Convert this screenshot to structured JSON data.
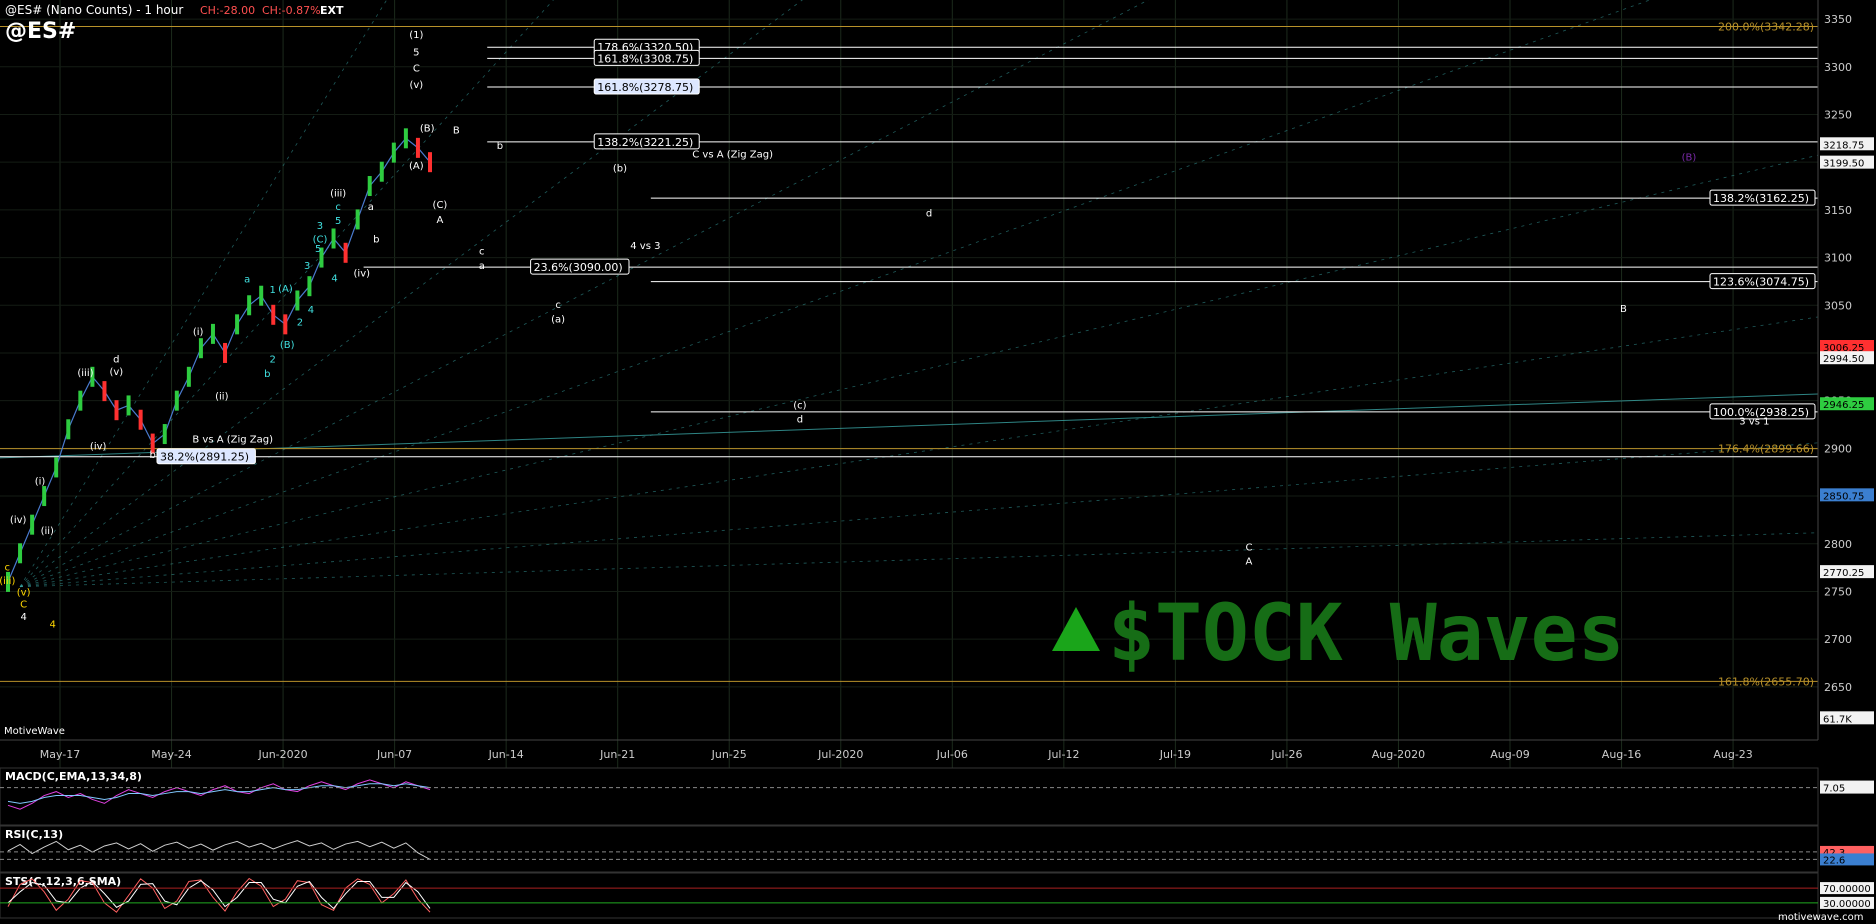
{
  "header": {
    "title": "@ES# (Nano Counts) - 1 hour",
    "change_abs": "CH:-28.00",
    "change_pct": "CH:-0.87%",
    "session": "EXT",
    "symbol": "@ES#"
  },
  "watermark": {
    "brand": "$TOCK Waves",
    "provider": "MotiveWave",
    "footer_url": "motivewave.com"
  },
  "colors": {
    "background": "#000000",
    "grid": "#1c2a1c",
    "fib_line": "#ffffff",
    "gold_line": "#b8912a",
    "fan_line": "#3aa6a6",
    "macd_main": "#e040e0",
    "macd_signal": "#80c8ff",
    "rsi": "#cfcfcf",
    "stoch_k": "#ff6060",
    "stoch_d": "#ffffff",
    "up_candle": "#2ecc40",
    "down_candle": "#ff3030",
    "brand_green": "#1aa51a",
    "brand_brown": "#6b4a1f"
  },
  "chart_data": [
    {
      "type": "line",
      "title": "@ES# (Nano Counts) - 1 hour",
      "ylim": [
        2610,
        3370
      ],
      "y_ticks": [
        2650,
        2700,
        2750,
        2800,
        2850,
        2900,
        2950,
        3000,
        3050,
        3100,
        3150,
        3200,
        3250,
        3300,
        3350
      ],
      "x_ticks": [
        "May-17",
        "May-24",
        "Jun-2020",
        "Jun-07",
        "Jun-14",
        "Jun-21",
        "Jun-25",
        "Jul-2020",
        "Jul-06",
        "Jul-12",
        "Jul-19",
        "Jul-26",
        "Aug-2020",
        "Aug-09",
        "Aug-16",
        "Aug-23"
      ],
      "price_series": {
        "name": "@ES#",
        "values": [
          2760,
          2790,
          2820,
          2850,
          2880,
          2920,
          2950,
          2975,
          2960,
          2940,
          2945,
          2930,
          2905,
          2915,
          2950,
          2975,
          3005,
          3020,
          3000,
          3030,
          3050,
          3060,
          3040,
          3030,
          3055,
          3070,
          3100,
          3120,
          3105,
          3140,
          3175,
          3190,
          3210,
          3225,
          3215,
          3200
        ]
      },
      "price_tags": [
        {
          "label": "3218.75",
          "value": 3218.75,
          "color": "#ffffff"
        },
        {
          "label": "3199.50",
          "value": 3199.5,
          "color": "#ffffff"
        },
        {
          "label": "3006.25",
          "value": 3006.25,
          "color": "#ff3030"
        },
        {
          "label": "2994.50",
          "value": 2994.5,
          "color": "#ffffff"
        },
        {
          "label": "2946.25",
          "value": 2946.25,
          "color": "#2ecc40"
        },
        {
          "label": "2850.75",
          "value": 2850.75,
          "color": "#3b7fd0"
        },
        {
          "label": "2770.25",
          "value": 2770.25,
          "color": "#ffffff"
        },
        {
          "label": "61.7K",
          "value": 2617,
          "color": "#ffffff"
        }
      ],
      "fib_levels": [
        {
          "label": "200.0%(3342.28)",
          "value": 3342.28,
          "color": "#b8912a",
          "start": 0.0,
          "boxed": false
        },
        {
          "label": "178.6%(3320.50)",
          "value": 3320.5,
          "color": "#ffffff",
          "start": 0.268,
          "boxed": true
        },
        {
          "label": "161.8%(3308.75)",
          "value": 3308.75,
          "color": "#ffffff",
          "start": 0.268,
          "boxed": true
        },
        {
          "label": "161.8%(3278.75)",
          "value": 3278.75,
          "color": "#ffffff",
          "start": 0.268,
          "boxed": true
        },
        {
          "label": "138.2%(3221.25)",
          "value": 3221.25,
          "color": "#ffffff",
          "start": 0.268,
          "boxed": true
        },
        {
          "label": "138.2%(3162.25)",
          "value": 3162.25,
          "color": "#ffffff",
          "start": 0.358,
          "boxed": true
        },
        {
          "label": "23.6%(3090.00)",
          "value": 3090.0,
          "color": "#ffffff",
          "start": 0.2,
          "boxed": true
        },
        {
          "label": "123.6%(3074.75)",
          "value": 3074.75,
          "color": "#ffffff",
          "start": 0.358,
          "boxed": true
        },
        {
          "label": "100.0%(2938.25)",
          "value": 2938.25,
          "color": "#ffffff",
          "start": 0.358,
          "boxed": true
        },
        {
          "label": "176.4%(2899.66)",
          "value": 2899.66,
          "color": "#b8912a",
          "start": 0.0,
          "boxed": false
        },
        {
          "label": "38.2%(2891.25)",
          "value": 2891.25,
          "color": "#ffffff",
          "start": 0.0,
          "boxed": true
        },
        {
          "label": "161.8%(2655.70)",
          "value": 2655.7,
          "color": "#b8912a",
          "start": 0.0,
          "boxed": false
        }
      ],
      "annotations": [
        {
          "text": "(1)",
          "x": 0.229,
          "value": 3330,
          "color": "#ffffff"
        },
        {
          "text": "5",
          "x": 0.229,
          "value": 3312,
          "color": "#ffffff"
        },
        {
          "text": "C",
          "x": 0.229,
          "value": 3295,
          "color": "#ffffff"
        },
        {
          "text": "(v)",
          "x": 0.229,
          "value": 3278,
          "color": "#ffffff"
        },
        {
          "text": "(B)",
          "x": 0.235,
          "value": 3232,
          "color": "#ffffff"
        },
        {
          "text": "(A)",
          "x": 0.229,
          "value": 3193,
          "color": "#ffffff"
        },
        {
          "text": "(C)",
          "x": 0.242,
          "value": 3152,
          "color": "#ffffff"
        },
        {
          "text": "A",
          "x": 0.242,
          "value": 3136,
          "color": "#ffffff"
        },
        {
          "text": "B",
          "x": 0.251,
          "value": 3230,
          "color": "#ffffff"
        },
        {
          "text": "b",
          "x": 0.275,
          "value": 3214,
          "color": "#ffffff"
        },
        {
          "text": "(b)",
          "x": 0.341,
          "value": 3190,
          "color": "#ffffff"
        },
        {
          "text": "C vs A (Zig Zag)",
          "x": 0.403,
          "value": 3205,
          "color": "#ffffff"
        },
        {
          "text": "4 vs 3",
          "x": 0.355,
          "value": 3109,
          "color": "#ffffff"
        },
        {
          "text": "c",
          "x": 0.265,
          "value": 3103,
          "color": "#ffffff"
        },
        {
          "text": "a",
          "x": 0.265,
          "value": 3088,
          "color": "#ffffff"
        },
        {
          "text": "c",
          "x": 0.307,
          "value": 3047,
          "color": "#ffffff"
        },
        {
          "text": "(a)",
          "x": 0.307,
          "value": 3032,
          "color": "#ffffff"
        },
        {
          "text": "d",
          "x": 0.511,
          "value": 3143,
          "color": "#ffffff"
        },
        {
          "text": "B",
          "x": 0.893,
          "value": 3043,
          "color": "#ffffff"
        },
        {
          "text": "(c)",
          "x": 0.44,
          "value": 2942,
          "color": "#ffffff"
        },
        {
          "text": "d",
          "x": 0.44,
          "value": 2927,
          "color": "#ffffff"
        },
        {
          "text": "3 vs 1",
          "x": 0.965,
          "value": 2925,
          "color": "#ffffff"
        },
        {
          "text": "C",
          "x": 0.687,
          "value": 2793,
          "color": "#ffffff"
        },
        {
          "text": "A",
          "x": 0.687,
          "value": 2778,
          "color": "#ffffff"
        },
        {
          "text": "B vs A (Zig Zag)",
          "x": 0.128,
          "value": 2906,
          "color": "#ffffff"
        },
        {
          "text": "b",
          "x": 0.084,
          "value": 2890,
          "color": "#ffffff"
        },
        {
          "text": "(B)",
          "x": 0.929,
          "value": 3202,
          "color": "#7a2aa8"
        },
        {
          "text": "(iii)",
          "x": 0.186,
          "value": 3164,
          "color": "#ffffff"
        },
        {
          "text": "(iv)",
          "x": 0.199,
          "value": 3080,
          "color": "#ffffff"
        },
        {
          "text": "(i)",
          "x": 0.109,
          "value": 3019,
          "color": "#ffffff"
        },
        {
          "text": "(ii)",
          "x": 0.122,
          "value": 2951,
          "color": "#ffffff"
        },
        {
          "text": "(iii)",
          "x": 0.047,
          "value": 2976,
          "color": "#ffffff"
        },
        {
          "text": "d",
          "x": 0.064,
          "value": 2990,
          "color": "#ffffff"
        },
        {
          "text": "(v)",
          "x": 0.064,
          "value": 2977,
          "color": "#ffffff"
        },
        {
          "text": "(iv)",
          "x": 0.054,
          "value": 2899,
          "color": "#ffffff"
        },
        {
          "text": "(i)",
          "x": 0.022,
          "value": 2862,
          "color": "#ffffff"
        },
        {
          "text": "(ii)",
          "x": 0.026,
          "value": 2810,
          "color": "#ffffff"
        },
        {
          "text": "(iv)",
          "x": 0.01,
          "value": 2822,
          "color": "#ffffff"
        },
        {
          "text": "c",
          "x": 0.004,
          "value": 2772,
          "color": "#ffd700"
        },
        {
          "text": "(iii)",
          "x": 0.004,
          "value": 2758,
          "color": "#ffd700"
        },
        {
          "text": "(v)",
          "x": 0.013,
          "value": 2746,
          "color": "#ffd700"
        },
        {
          "text": "C",
          "x": 0.013,
          "value": 2733,
          "color": "#ffd700"
        },
        {
          "text": "4",
          "x": 0.013,
          "value": 2720,
          "color": "#ffffff"
        },
        {
          "text": "4",
          "x": 0.029,
          "value": 2712,
          "color": "#ffd700"
        },
        {
          "text": "a",
          "x": 0.136,
          "value": 3074,
          "color": "#40e0e0"
        },
        {
          "text": "1",
          "x": 0.15,
          "value": 3063,
          "color": "#40e0e0"
        },
        {
          "text": "3",
          "x": 0.169,
          "value": 3088,
          "color": "#40e0e0"
        },
        {
          "text": "5",
          "x": 0.175,
          "value": 3106,
          "color": "#40e0e0"
        },
        {
          "text": "(C)",
          "x": 0.176,
          "value": 3116,
          "color": "#40e0e0"
        },
        {
          "text": "3",
          "x": 0.176,
          "value": 3130,
          "color": "#40e0e0"
        },
        {
          "text": "c",
          "x": 0.186,
          "value": 3150,
          "color": "#40e0e0"
        },
        {
          "text": "5",
          "x": 0.186,
          "value": 3135,
          "color": "#40e0e0"
        },
        {
          "text": "4",
          "x": 0.184,
          "value": 3075,
          "color": "#40e0e0"
        },
        {
          "text": "2",
          "x": 0.15,
          "value": 2990,
          "color": "#40e0e0"
        },
        {
          "text": "(B)",
          "x": 0.158,
          "value": 3005,
          "color": "#40e0e0"
        },
        {
          "text": "b",
          "x": 0.147,
          "value": 2975,
          "color": "#40e0e0"
        },
        {
          "text": "2",
          "x": 0.165,
          "value": 3029,
          "color": "#40e0e0"
        },
        {
          "text": "4",
          "x": 0.171,
          "value": 3042,
          "color": "#40e0e0"
        },
        {
          "text": "(A)",
          "x": 0.157,
          "value": 3064,
          "color": "#40e0e0"
        },
        {
          "text": "a",
          "x": 0.204,
          "value": 3150,
          "color": "#ffffff"
        },
        {
          "text": "b",
          "x": 0.207,
          "value": 3116,
          "color": "#ffffff"
        }
      ]
    },
    {
      "type": "line",
      "title": "MACD(C,EMA,13,34,8)",
      "ylim": [
        -10,
        15
      ],
      "y_tick_label": "7.05",
      "series": [
        {
          "name": "MACD",
          "values": [
            -2,
            -4,
            -1,
            3,
            5,
            2,
            4,
            1,
            -1,
            3,
            6,
            4,
            2,
            5,
            7,
            5,
            3,
            6,
            8,
            5,
            4,
            7,
            9,
            6,
            5,
            8,
            10,
            8,
            6,
            9,
            11,
            9,
            7,
            10,
            8,
            6
          ]
        },
        {
          "name": "Signal",
          "values": [
            0,
            -1,
            0,
            2,
            3,
            3,
            3,
            2,
            1,
            2,
            4,
            4,
            3,
            4,
            5,
            5,
            4,
            5,
            6,
            5,
            5,
            6,
            7,
            6,
            6,
            7,
            8,
            8,
            7,
            8,
            9,
            9,
            8,
            9,
            8,
            7
          ]
        }
      ]
    },
    {
      "type": "line",
      "title": "RSI(C,13)",
      "ylim": [
        0,
        100
      ],
      "y_tick_labels": [
        "42.3",
        "22.6"
      ],
      "series": [
        {
          "name": "RSI",
          "values": [
            45,
            62,
            38,
            55,
            70,
            48,
            60,
            42,
            58,
            66,
            50,
            64,
            44,
            60,
            68,
            52,
            63,
            47,
            61,
            70,
            55,
            65,
            50,
            62,
            72,
            58,
            66,
            49,
            63,
            70,
            56,
            68,
            52,
            66,
            40,
            22.6
          ]
        }
      ]
    },
    {
      "type": "line",
      "title": "STS(C,12,3,6,SMA)",
      "ylim": [
        0,
        100
      ],
      "y_tick_labels": [
        "70.00000",
        "30.00000"
      ],
      "series": [
        {
          "name": "%K",
          "values": [
            20,
            80,
            95,
            60,
            10,
            40,
            90,
            85,
            30,
            5,
            50,
            95,
            70,
            15,
            35,
            88,
            92,
            45,
            8,
            60,
            96,
            75,
            20,
            40,
            90,
            85,
            25,
            10,
            70,
            95,
            80,
            30,
            55,
            92,
            40,
            5
          ]
        },
        {
          "name": "%D",
          "values": [
            30,
            60,
            85,
            78,
            35,
            30,
            70,
            88,
            55,
            18,
            35,
            80,
            82,
            35,
            25,
            70,
            90,
            65,
            20,
            45,
            85,
            85,
            40,
            30,
            75,
            88,
            45,
            15,
            55,
            88,
            88,
            45,
            45,
            85,
            60,
            15
          ]
        }
      ]
    }
  ]
}
